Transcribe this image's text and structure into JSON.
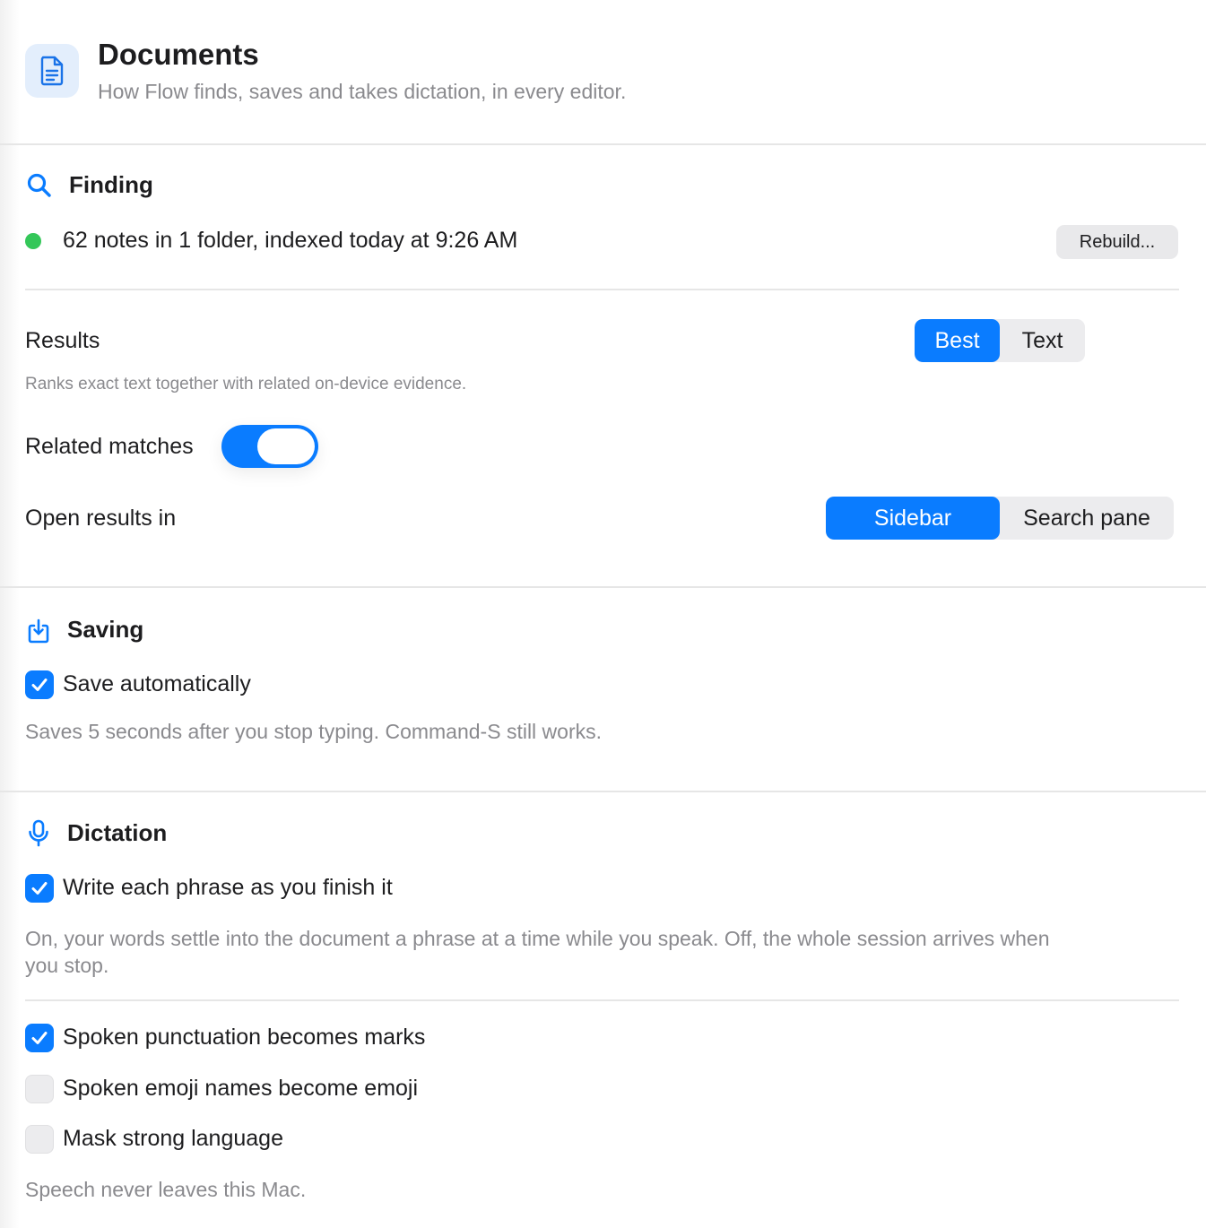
{
  "header": {
    "icon": "document-icon",
    "title": "Documents",
    "subtitle": "How Flow finds, saves and takes dictation, in every editor."
  },
  "finding": {
    "icon": "search-icon",
    "title": "Finding",
    "status": {
      "text": "62 notes in 1 folder, indexed today at 9:26 AM",
      "dot_color": "#34c759"
    },
    "rebuild_label": "Rebuild...",
    "results": {
      "label": "Results",
      "options": [
        "Best",
        "Text"
      ],
      "selected": "Best",
      "hint": "Ranks exact text together with related on-device evidence."
    },
    "related_matches": {
      "label": "Related matches",
      "on": true
    },
    "open_results": {
      "label": "Open results in",
      "options": [
        "Sidebar",
        "Search pane"
      ],
      "selected": "Sidebar"
    }
  },
  "saving": {
    "icon": "save-icon",
    "title": "Saving",
    "save_automatically": {
      "label": "Save automatically",
      "checked": true
    },
    "hint": "Saves 5 seconds after you stop typing. Command-S still works."
  },
  "dictation": {
    "icon": "microphone-icon",
    "title": "Dictation",
    "write_each_phrase": {
      "label": "Write each phrase as you finish it",
      "checked": true
    },
    "write_hint_line1": "On, your words settle into the document a phrase at a time while you speak. Off, the whole session arrives when",
    "write_hint_line2": "you stop.",
    "options": [
      {
        "label": "Spoken punctuation becomes marks",
        "checked": true
      },
      {
        "label": "Spoken emoji names become emoji",
        "checked": false
      },
      {
        "label": "Mask strong language",
        "checked": false
      }
    ],
    "footer": "Speech never leaves this Mac."
  },
  "colors": {
    "accent": "#0a7cff",
    "status_green": "#34c759",
    "secondary_text": "#8a8a8e"
  }
}
